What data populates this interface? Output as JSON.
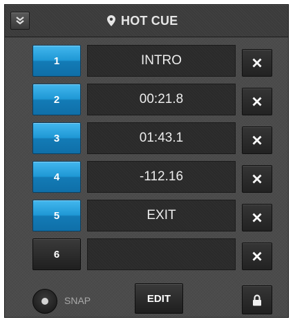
{
  "header": {
    "title": "HOT CUE",
    "collapse_icon": "double-chevron-down-icon",
    "title_icon": "map-pin-icon"
  },
  "cues": [
    {
      "number": "1",
      "label": "INTRO",
      "set": true
    },
    {
      "number": "2",
      "label": "00:21.8",
      "set": true
    },
    {
      "number": "3",
      "label": "01:43.1",
      "set": true
    },
    {
      "number": "4",
      "label": "-112.16",
      "set": true
    },
    {
      "number": "5",
      "label": "EXIT",
      "set": true
    },
    {
      "number": "6",
      "label": "",
      "set": false
    }
  ],
  "delete_icon": "close-x-icon",
  "footer": {
    "snap_label": "SNAP",
    "edit_label": "EDIT",
    "lock_icon": "lock-icon"
  },
  "colors": {
    "cue_active": "#1f98d5",
    "panel_bg": "#4b4b4b",
    "label_bg": "#2a2a2a"
  }
}
